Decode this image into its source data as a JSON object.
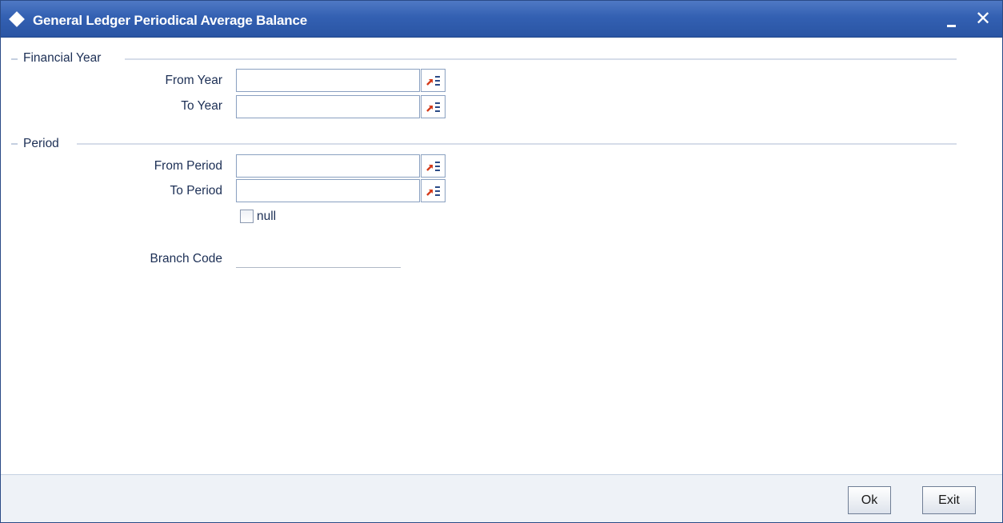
{
  "window": {
    "title": "General Ledger Periodical Average Balance",
    "close_glyph": "✕"
  },
  "financial_year": {
    "legend": "Financial Year",
    "from_label": "From Year",
    "from_value": "",
    "to_label": "To Year",
    "to_value": ""
  },
  "period": {
    "legend": "Period",
    "from_label": "From Period",
    "from_value": "",
    "to_label": "To Period",
    "to_value": "",
    "checkbox_label": "null",
    "checkbox_checked": false
  },
  "branch": {
    "label": "Branch Code",
    "value": ""
  },
  "footer": {
    "ok_label": "Ok",
    "exit_label": "Exit"
  },
  "icons": {
    "window": "diamond-icon",
    "minimize": "minimize-icon",
    "close": "close-icon",
    "lov": "list-of-values-icon"
  },
  "colors": {
    "titlebar": "#3360b2",
    "label_text": "#1c2f55",
    "lov_arrow": "#d43a1a",
    "lov_lines": "#2a4a86"
  }
}
